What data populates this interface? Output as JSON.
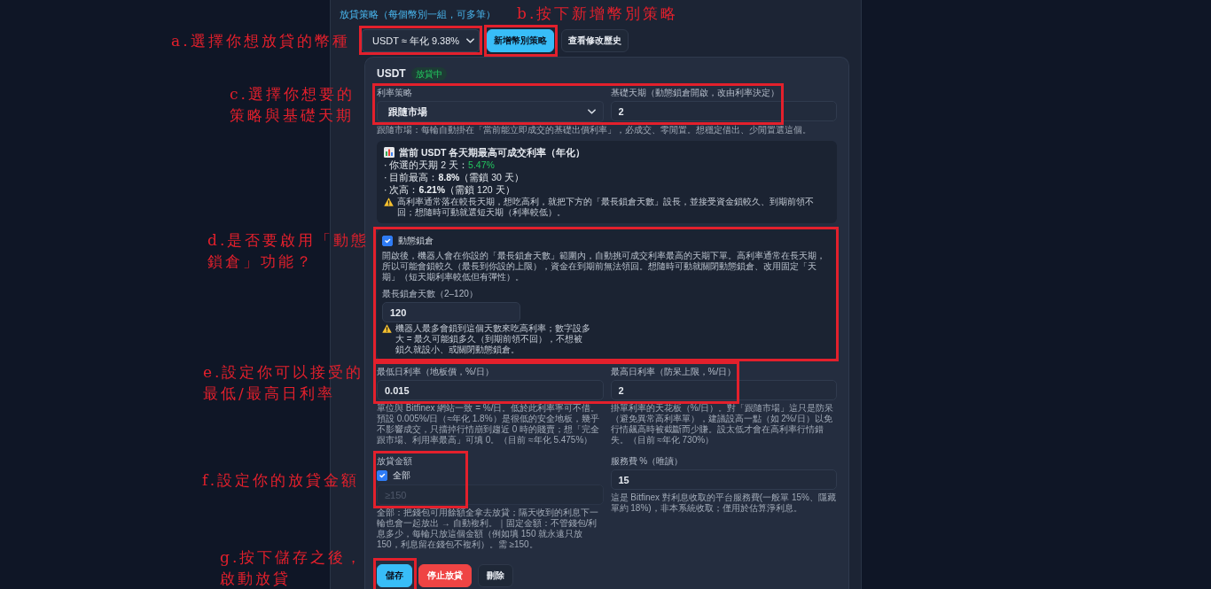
{
  "panel": {
    "title": "放貸策略（每個幣別一組，可多筆）",
    "currency_select": {
      "value": "USDT ≈ 年化 9.38%"
    },
    "buttons": [
      {
        "label": "新增幣別策略",
        "kind": "primary"
      },
      {
        "label": "查看修改歷史",
        "kind": "secondary"
      }
    ]
  },
  "strategy_card": {
    "currency": "USDT",
    "status_badge": "放貸中",
    "rate_strategy": {
      "label": "利率策略",
      "value": "跟隨市場"
    },
    "base_period": {
      "label": "基礎天期（動態鎖倉開啟，改由利率決定）",
      "value": "2"
    },
    "strategy_hint": "跟隨市場：每輪自動掛在「當前能立即成交的基礎出價利率」，必成交、零閒置。想穩定借出、少閒置選這個。",
    "rate_info": {
      "title": "當前 USDT 各天期最高可成交利率（年化）",
      "lines": [
        {
          "kind": "current",
          "text": "· 你選的天期 2 天：**5.47%**"
        },
        {
          "kind": "best",
          "text": "· 目前最高：**8.8%**（需鎖 30 天）"
        },
        {
          "kind": "best",
          "text": "· 次高：**6.21%**（需鎖 120 天）"
        }
      ],
      "note": "高利率通常落在較長天期，想吃高利，就把下方的「最長鎖倉天數」設長，並接受資金鎖較久、到期前領不回；想隨時可動就選短天期（利率較低）。"
    },
    "dynamic_lock": {
      "label": "動態鎖倉",
      "checked": true,
      "description": "開啟後，機器人會在你設的「最長鎖倉天數」範圍內，自動挑可成交利率最高的天期下單。高利率通常在長天期，所以可能會鎖較久（最長到你設的上限），資金在到期前無法領回。想隨時可動就關閉動態鎖倉、改用固定「天期」（短天期利率較低但有彈性）。",
      "max_days": {
        "label": "最長鎖倉天數（2–120）",
        "value": "120"
      },
      "note": "機器人最多會鎖到這個天數來吃高利率；數字設多大 = 最久可能鎖多久（到期前領不回），不想被鎖久就設小、或關閉動態鎖倉。"
    },
    "min_rate": {
      "label": "最低日利率（地板價，%/日）",
      "value": "0.015",
      "hint": "單位與 Bitfinex 網站一致 = %/日。低於此利率寧可不借。預設 0.005%/日（≈年化 1.8%）是很低的安全地板，幾乎不影響成交，只擋掉行情崩到趨近 0 時的賤賣；想「完全跟市場、利用率最高」可填 0。（目前 ≈年化 5.475%）"
    },
    "max_rate": {
      "label": "最高日利率（防呆上限，%/日）",
      "value": "2",
      "hint": "掛單利率的天花板（%/日）。對「跟隨市場」這只是防呆（避免異常高利率單），建議設高一點（如 2%/日）以免行情飆高時被截斷而少賺。設太低才會在高利率行情錯失。（目前 ≈年化 730%）"
    },
    "amount": {
      "label": "放貸金額",
      "all": {
        "label": "全部",
        "checked": true
      },
      "placeholder": "≥150",
      "disabled": true,
      "hint": "全部：把錢包可用餘額全拿去放貸；隔天收到的利息下一輪也會一起放出 → 自動複利。｜固定金額：不管錢包/利息多少，每輪只放這個金額（例如填 150 就永遠只放 150，利息留在錢包不複利）。需 ≥150。"
    },
    "service_fee": {
      "label": "服務費 %（唯讀）",
      "value": "15",
      "hint": "這是 Bitfinex 對利息收取的平台服務費(一般單 15%、隱藏單約 18%)，非本系統收取；僅用於估算淨利息。"
    },
    "actions": [
      {
        "label": "儲存",
        "kind": "primary"
      },
      {
        "label": "停止放貸",
        "kind": "danger"
      },
      {
        "label": "刪除",
        "kind": "secondary"
      }
    ]
  },
  "annotations": [
    {
      "lines": [
        "a.選擇你想放貸的幣種"
      ]
    },
    {
      "lines": [
        "b.按下新增幣別策略"
      ]
    },
    {
      "lines": [
        "c.選擇你想要的",
        "策略與基礎天期"
      ]
    },
    {
      "lines": [
        "d.是否要啟用「動態",
        "鎖倉」功能？"
      ]
    },
    {
      "lines": [
        "e.設定你可以接受的",
        "最低/最高日利率"
      ]
    },
    {
      "lines": [
        "f.設定你的放貸金額"
      ]
    },
    {
      "lines": [
        "g.按下儲存之後，",
        "啟動放貸"
      ]
    }
  ]
}
